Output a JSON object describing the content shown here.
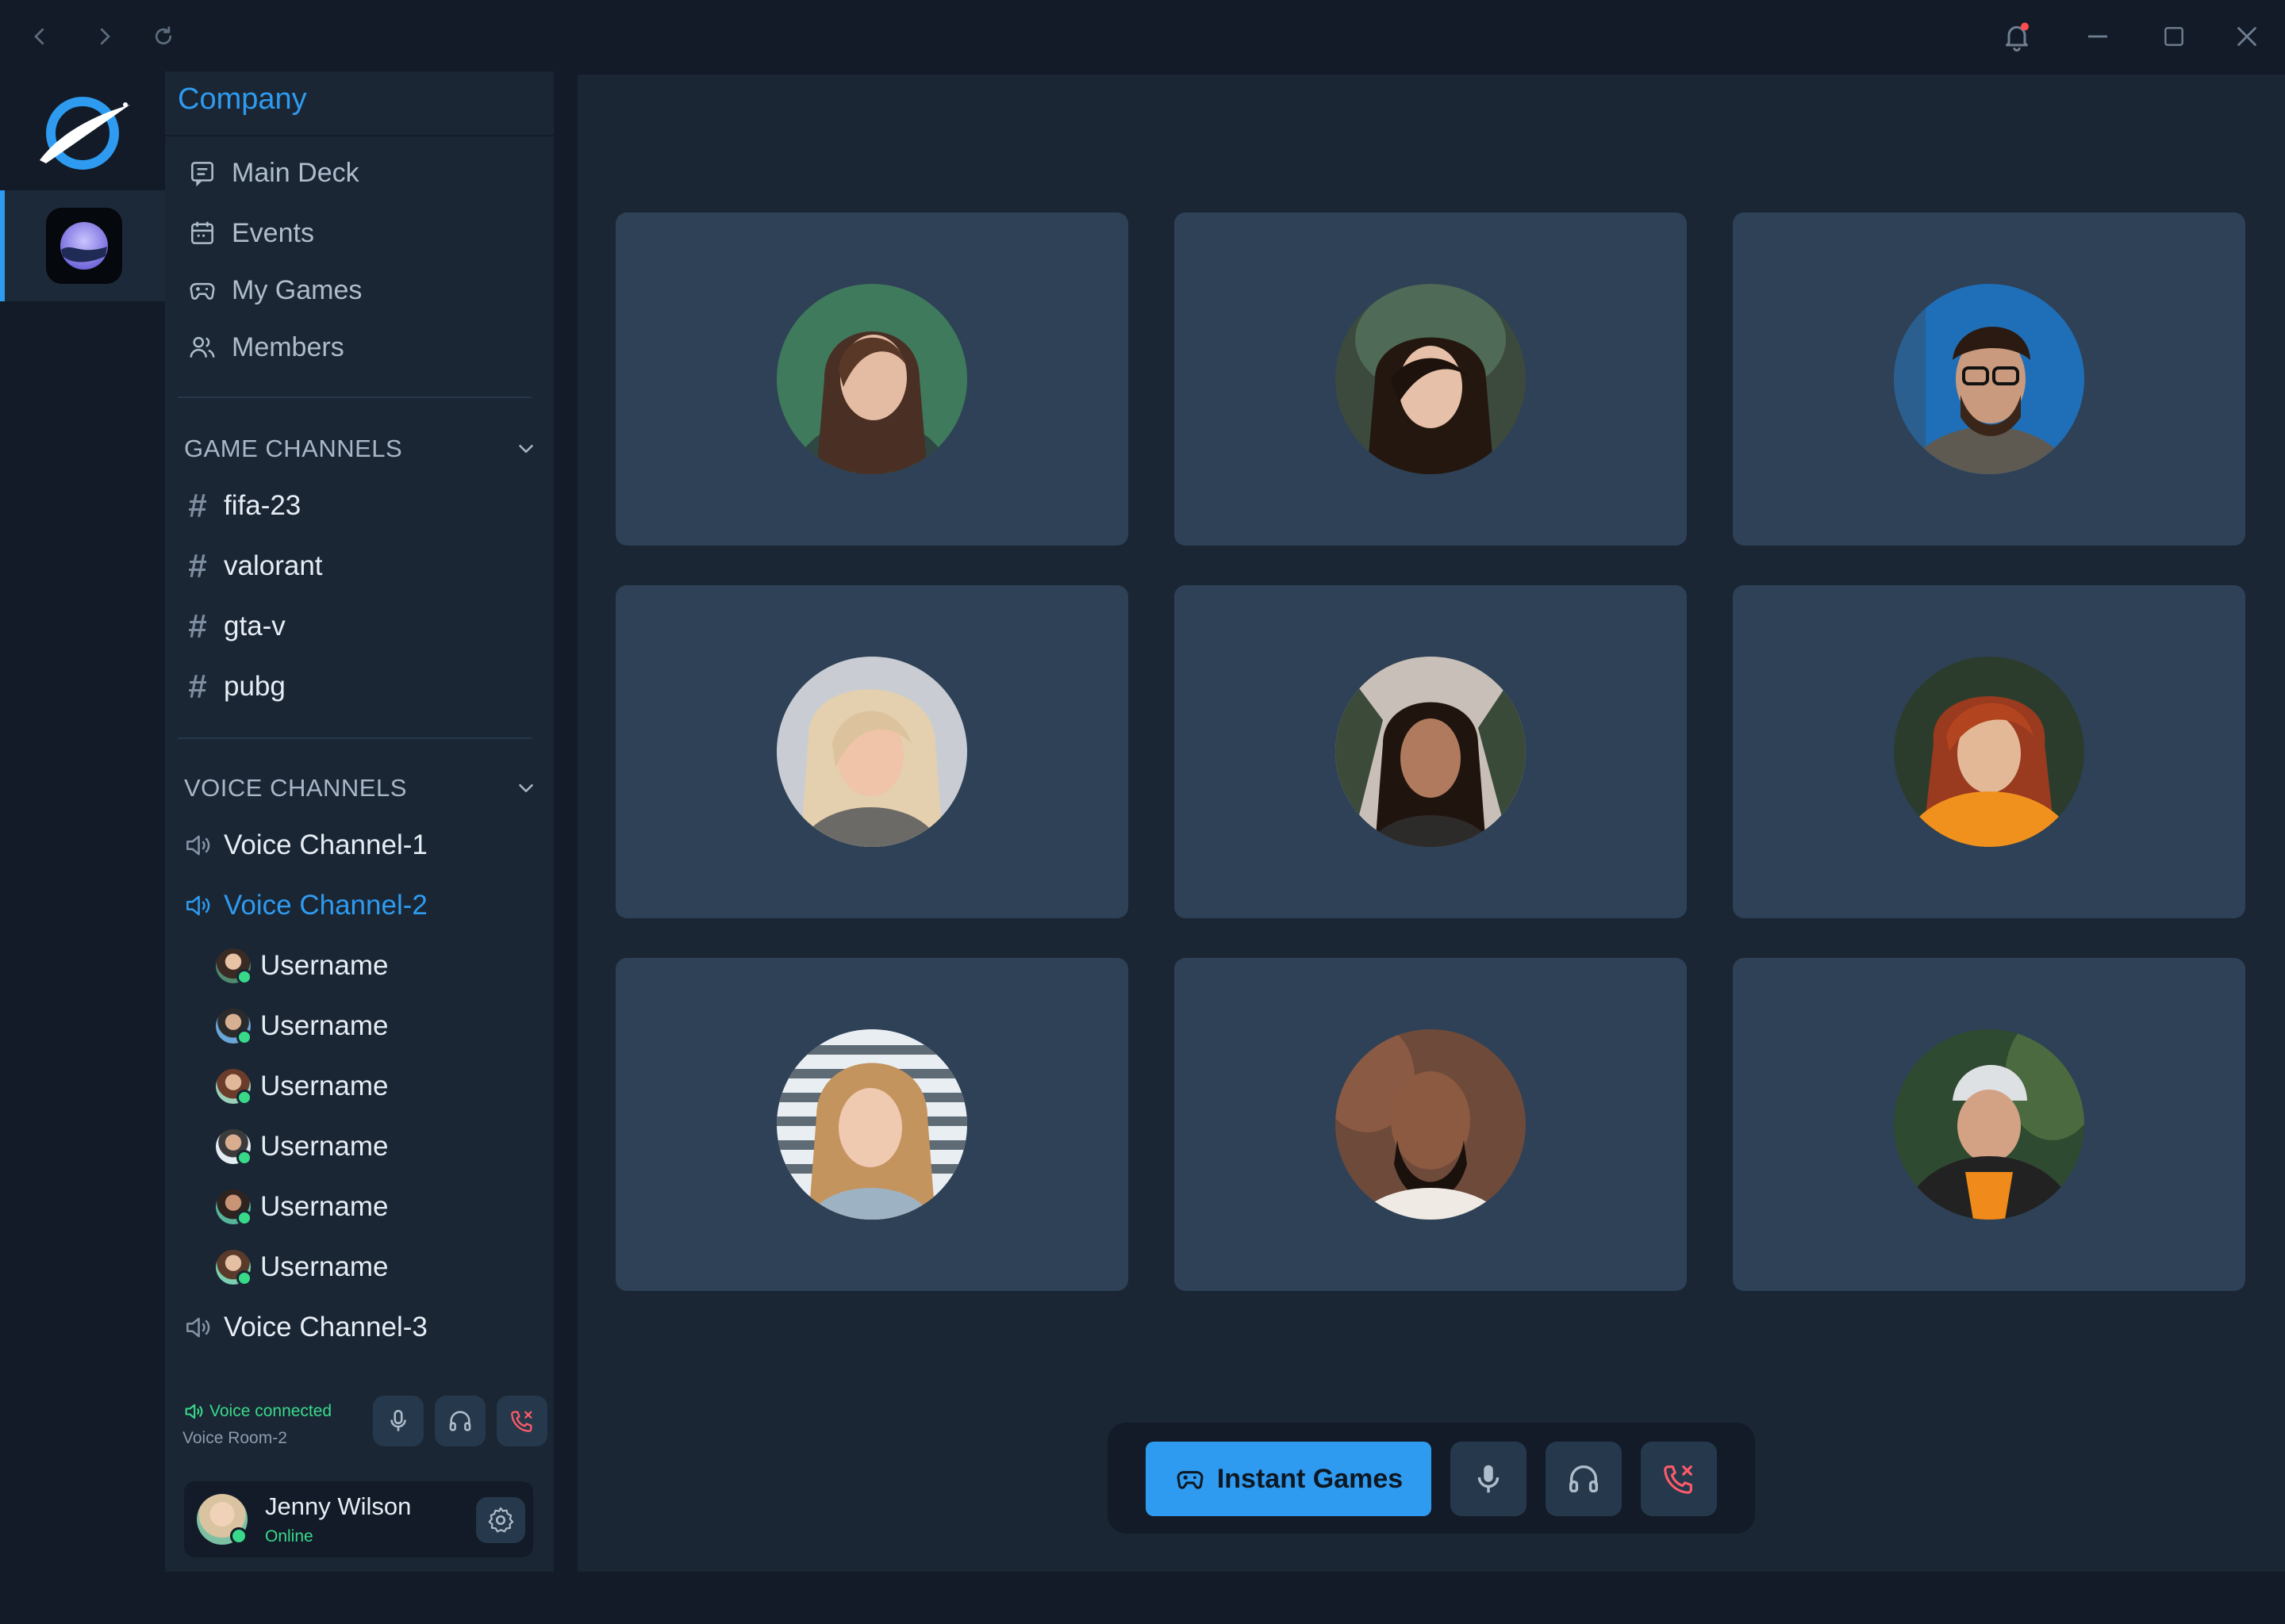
{
  "window": {
    "notification_dot_color": "#ff4d4f",
    "icons": [
      "back-icon",
      "forward-icon",
      "reload-icon",
      "bell-icon",
      "minimize-icon",
      "maximize-icon",
      "close-icon"
    ]
  },
  "colors": {
    "accent": "#2e9bf0",
    "online": "#39d98a",
    "danger": "#ff5b6a"
  },
  "sidebar": {
    "company": "Company",
    "nav": [
      {
        "label": "Main Deck",
        "icon": "chat-icon"
      },
      {
        "label": "Events",
        "icon": "calendar-icon"
      },
      {
        "label": "My Games",
        "icon": "gamepad-icon"
      },
      {
        "label": "Members",
        "icon": "members-icon"
      }
    ],
    "game_channels": {
      "title": "GAME CHANNELS",
      "channels": [
        "fifa-23",
        "valorant",
        "gta-v",
        "pubg"
      ]
    },
    "voice_channels": {
      "title": "VOICE CHANNELS",
      "channels": [
        {
          "label": "Voice Channel-1",
          "active": false
        },
        {
          "label": "Voice Channel-2",
          "active": true
        },
        {
          "label": "Voice Channel-3",
          "active": false
        }
      ],
      "members": [
        "Username",
        "Username",
        "Username",
        "Username",
        "Username",
        "Username"
      ]
    },
    "voice_status": {
      "status": "Voice connected",
      "room": "Voice Room-2"
    },
    "user": {
      "name": "Jenny Wilson",
      "status": "Online"
    }
  },
  "main": {
    "participants": 9,
    "instant_games_label": "Instant Games"
  }
}
